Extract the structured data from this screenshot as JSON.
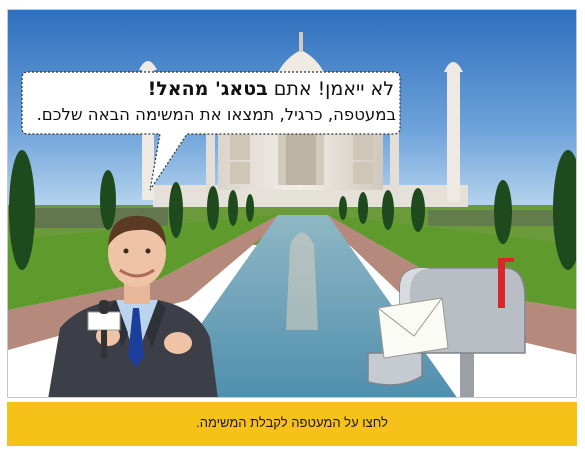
{
  "speech_bubble": {
    "greeting": "לא ייאמן! אתם ",
    "highlight": "בטאג' מהאל!",
    "body": "במעטפה, כרגיל, תמצאו את המשימה הבאה שלכם."
  },
  "instruction_bar": {
    "text": "לחצו על המעטפה לקבלת המשימה."
  },
  "colors": {
    "sky": "#4a86c8",
    "lawn": "#5e9a2c",
    "pool": "#6ea6c0",
    "instruction_bar": "#f6c21a",
    "mailbox_flag": "#d8262b"
  },
  "icons": {
    "mailbox": "mailbox-with-envelope-icon",
    "microphone": "microphone-icon"
  }
}
